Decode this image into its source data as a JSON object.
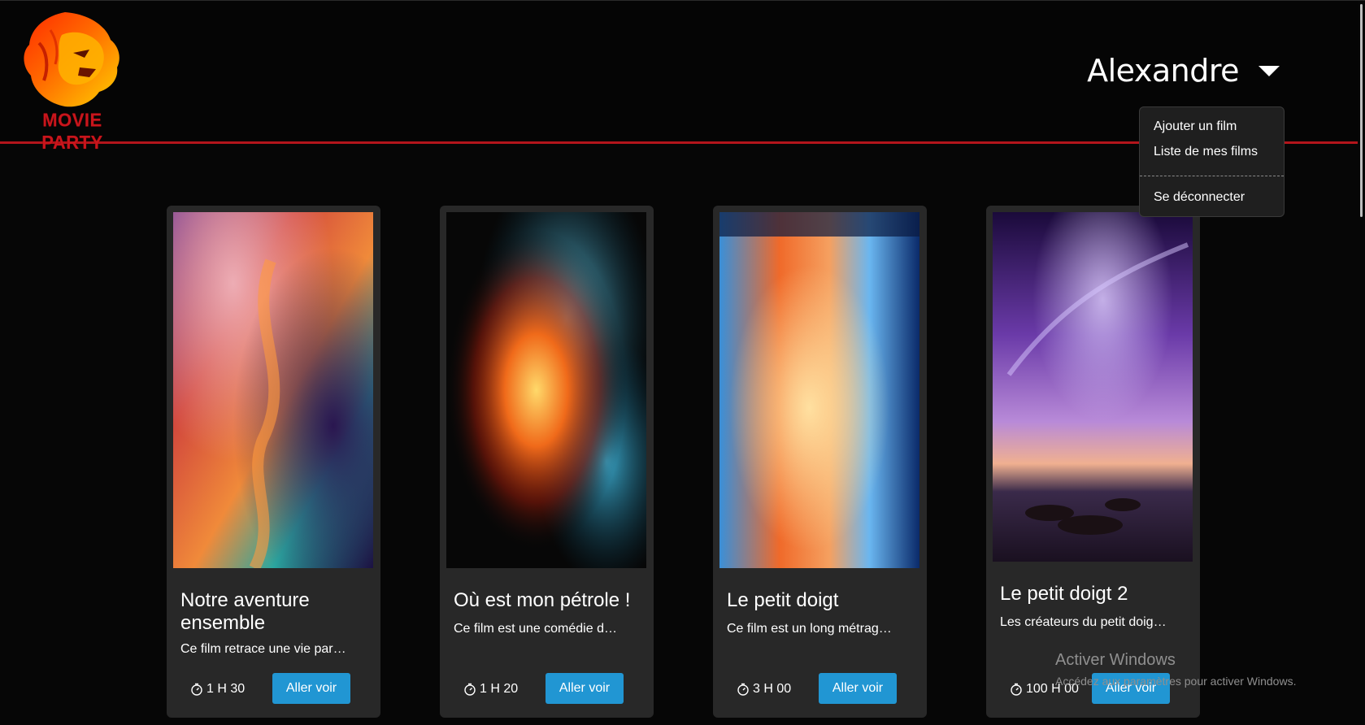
{
  "brand": {
    "name": "MOVIE PARTY",
    "logo_icon": "lion-head-icon"
  },
  "user_menu": {
    "username": "Alexandre",
    "items": [
      {
        "label": "Ajouter un film"
      },
      {
        "label": "Liste de mes films"
      },
      {
        "label": "Se déconnecter"
      }
    ]
  },
  "movies": [
    {
      "title": "Notre aventure ensemble",
      "description": "Ce film retrace une vie par…",
      "duration": "1 H 30",
      "button": "Aller voir"
    },
    {
      "title": "Où est mon pétrole !",
      "description": "Ce film est une comédie d…",
      "duration": "1 H 20",
      "button": "Aller voir"
    },
    {
      "title": "Le petit doigt",
      "description": "Ce film est un long métrag…",
      "duration": "3 H 00",
      "button": "Aller voir"
    },
    {
      "title": "Le petit doigt 2",
      "description": "Les créateurs du petit doig…",
      "duration": "100 H 00",
      "button": "Aller voir"
    }
  ],
  "watermark": {
    "title": "Activer Windows",
    "subtitle": "Accédez aux paramètres pour activer Windows."
  },
  "colors": {
    "accent_red": "#b3151b",
    "button_blue": "#2196d3",
    "card_bg": "#282828",
    "page_bg": "#060606"
  }
}
